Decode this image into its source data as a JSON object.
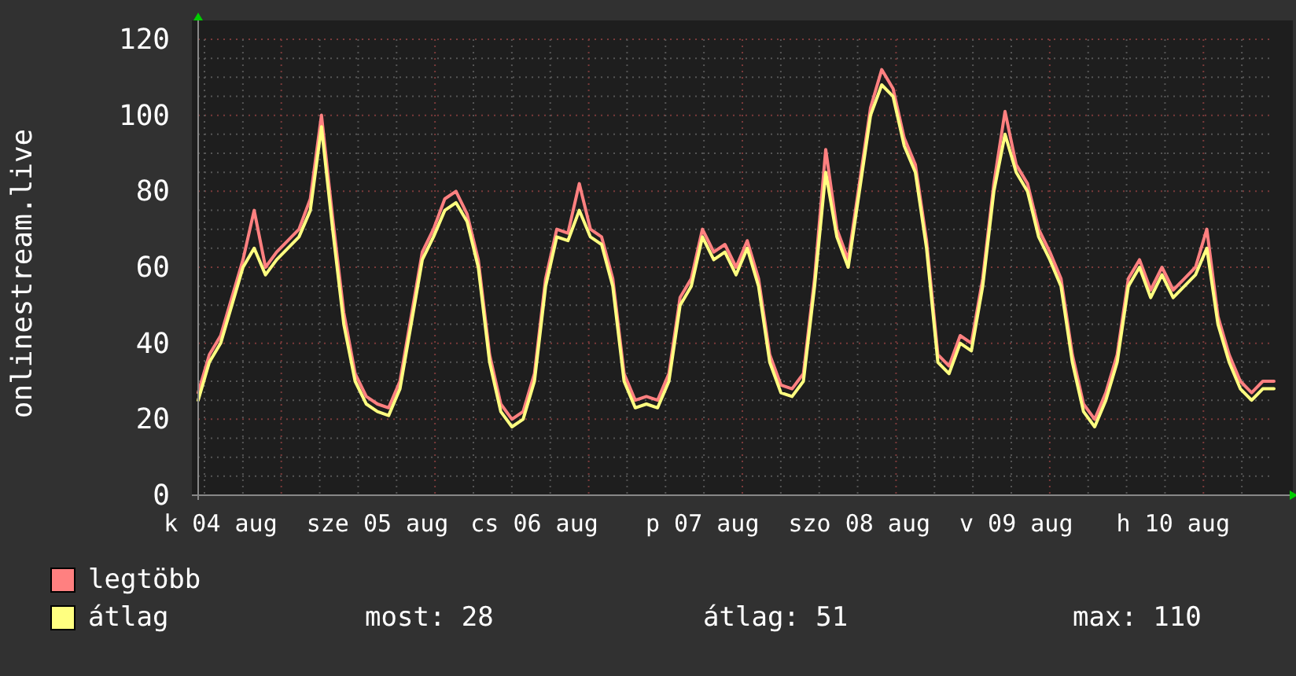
{
  "chart": {
    "chart_data": {
      "type": "line",
      "grid": true,
      "ylabel": "onlinestream.live",
      "ylim": [
        0,
        120
      ],
      "yticks": [
        0,
        20,
        40,
        60,
        80,
        100,
        120
      ],
      "categories": [
        null,
        null,
        "k 04 aug",
        null,
        null,
        null,
        null,
        null,
        null,
        null,
        null,
        null,
        null,
        null,
        null,
        null,
        "sze 05 aug",
        null,
        null,
        null,
        null,
        null,
        null,
        null,
        null,
        null,
        null,
        null,
        null,
        null,
        "cs 06 aug",
        null,
        null,
        null,
        null,
        null,
        null,
        null,
        null,
        null,
        null,
        null,
        null,
        null,
        null,
        "p 07 aug",
        null,
        null,
        null,
        null,
        null,
        null,
        null,
        null,
        null,
        null,
        null,
        null,
        null,
        "szo 08 aug",
        null,
        null,
        null,
        null,
        null,
        null,
        null,
        null,
        null,
        null,
        null,
        null,
        null,
        "v 09 aug",
        null,
        null,
        null,
        null,
        null,
        null,
        null,
        null,
        null,
        null,
        null,
        null,
        null,
        "h 10 aug",
        null,
        null,
        null,
        null,
        null,
        null,
        null,
        null,
        null
      ],
      "series": [
        {
          "name": "legtöbb",
          "color": "#ff8080",
          "values": [
            27,
            37,
            42,
            52,
            62,
            75,
            60,
            64,
            67,
            70,
            78,
            100,
            73,
            48,
            32,
            26,
            24,
            23,
            30,
            47,
            64,
            70,
            78,
            80,
            74,
            62,
            37,
            24,
            20,
            22,
            32,
            57,
            70,
            69,
            82,
            70,
            68,
            57,
            32,
            25,
            26,
            25,
            32,
            52,
            57,
            70,
            64,
            66,
            60,
            67,
            57,
            37,
            29,
            28,
            32,
            57,
            91,
            70,
            62,
            82,
            102,
            112,
            107,
            94,
            87,
            67,
            37,
            34,
            42,
            40,
            57,
            82,
            101,
            87,
            82,
            70,
            64,
            57,
            37,
            24,
            20,
            27,
            37,
            57,
            62,
            54,
            60,
            54,
            57,
            60,
            70,
            47,
            37,
            30,
            27,
            30,
            30
          ]
        },
        {
          "name": "átlag",
          "color": "#ffff80",
          "values": [
            25,
            35,
            40,
            50,
            60,
            65,
            58,
            62,
            65,
            68,
            75,
            97,
            70,
            45,
            30,
            24,
            22,
            21,
            28,
            45,
            62,
            68,
            75,
            77,
            72,
            60,
            35,
            22,
            18,
            20,
            30,
            55,
            68,
            67,
            75,
            68,
            66,
            55,
            30,
            23,
            24,
            23,
            30,
            50,
            55,
            68,
            62,
            64,
            58,
            65,
            55,
            35,
            27,
            26,
            30,
            55,
            85,
            68,
            60,
            80,
            100,
            108,
            105,
            92,
            85,
            65,
            35,
            32,
            40,
            38,
            55,
            80,
            95,
            85,
            80,
            68,
            62,
            55,
            35,
            22,
            18,
            25,
            35,
            55,
            60,
            52,
            58,
            52,
            55,
            58,
            65,
            45,
            35,
            28,
            25,
            28,
            28
          ]
        }
      ]
    }
  },
  "summary": [
    "most: 28",
    "átlag: 51",
    "max: 110"
  ]
}
